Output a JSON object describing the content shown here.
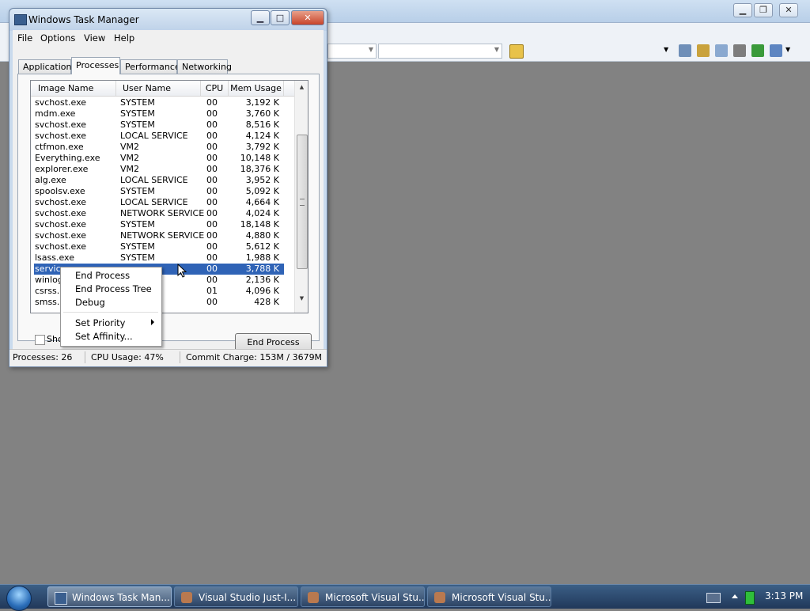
{
  "colors": {
    "desktop": "#828282",
    "selection": "#2f63b6",
    "taskbar": "#2b4769",
    "tray_meter": "#2fbf3a"
  },
  "background_window": {
    "controls": [
      "minimize-icon",
      "restore-icon",
      "close-icon"
    ]
  },
  "task_manager": {
    "title": "Windows Task Manager",
    "menu": [
      "File",
      "Options",
      "View",
      "Help"
    ],
    "tabs": [
      "Applications",
      "Processes",
      "Performance",
      "Networking"
    ],
    "active_tab": "Processes",
    "columns": [
      "Image Name",
      "User Name",
      "CPU",
      "Mem Usage"
    ],
    "processes": [
      {
        "name": "svchost.exe",
        "user": "SYSTEM",
        "cpu": "00",
        "mem": "3,192 K"
      },
      {
        "name": "mdm.exe",
        "user": "SYSTEM",
        "cpu": "00",
        "mem": "3,760 K"
      },
      {
        "name": "svchost.exe",
        "user": "SYSTEM",
        "cpu": "00",
        "mem": "8,516 K"
      },
      {
        "name": "svchost.exe",
        "user": "LOCAL SERVICE",
        "cpu": "00",
        "mem": "4,124 K"
      },
      {
        "name": "ctfmon.exe",
        "user": "VM2",
        "cpu": "00",
        "mem": "3,792 K"
      },
      {
        "name": "Everything.exe",
        "user": "VM2",
        "cpu": "00",
        "mem": "10,148 K"
      },
      {
        "name": "explorer.exe",
        "user": "VM2",
        "cpu": "00",
        "mem": "18,376 K"
      },
      {
        "name": "alg.exe",
        "user": "LOCAL SERVICE",
        "cpu": "00",
        "mem": "3,952 K"
      },
      {
        "name": "spoolsv.exe",
        "user": "SYSTEM",
        "cpu": "00",
        "mem": "5,092 K"
      },
      {
        "name": "svchost.exe",
        "user": "LOCAL SERVICE",
        "cpu": "00",
        "mem": "4,664 K"
      },
      {
        "name": "svchost.exe",
        "user": "NETWORK SERVICE",
        "cpu": "00",
        "mem": "4,024 K"
      },
      {
        "name": "svchost.exe",
        "user": "SYSTEM",
        "cpu": "00",
        "mem": "18,148 K"
      },
      {
        "name": "svchost.exe",
        "user": "NETWORK SERVICE",
        "cpu": "00",
        "mem": "4,880 K"
      },
      {
        "name": "svchost.exe",
        "user": "SYSTEM",
        "cpu": "00",
        "mem": "5,612 K"
      },
      {
        "name": "lsass.exe",
        "user": "SYSTEM",
        "cpu": "00",
        "mem": "1,988 K"
      },
      {
        "name": "service",
        "user": "",
        "cpu": "00",
        "mem": "3,788 K"
      },
      {
        "name": "winlog",
        "user": "",
        "cpu": "00",
        "mem": "2,136 K"
      },
      {
        "name": "csrss.e",
        "user": "",
        "cpu": "01",
        "mem": "4,096 K"
      },
      {
        "name": "smss.e",
        "user": "",
        "cpu": "00",
        "mem": "428 K"
      }
    ],
    "selected_index": 15,
    "show_all_label": "Show",
    "end_process_button": "End Process",
    "status": {
      "processes": "Processes: 26",
      "cpu_usage": "CPU Usage: 47%",
      "commit_charge": "Commit Charge: 153M / 3679M"
    }
  },
  "context_menu": {
    "items": [
      "End Process",
      "End Process Tree",
      "Debug",
      "Set Priority",
      "Set Affinity..."
    ]
  },
  "taskbar": {
    "buttons": [
      {
        "label": "Windows Task Man...",
        "icon": "task-manager-icon"
      },
      {
        "label": "Visual Studio Just-I...",
        "icon": "visual-studio-icon"
      },
      {
        "label": "Microsoft Visual Stu...",
        "icon": "visual-studio-icon"
      },
      {
        "label": "Microsoft Visual Stu...",
        "icon": "visual-studio-icon"
      }
    ],
    "clock": "3:13 PM"
  }
}
